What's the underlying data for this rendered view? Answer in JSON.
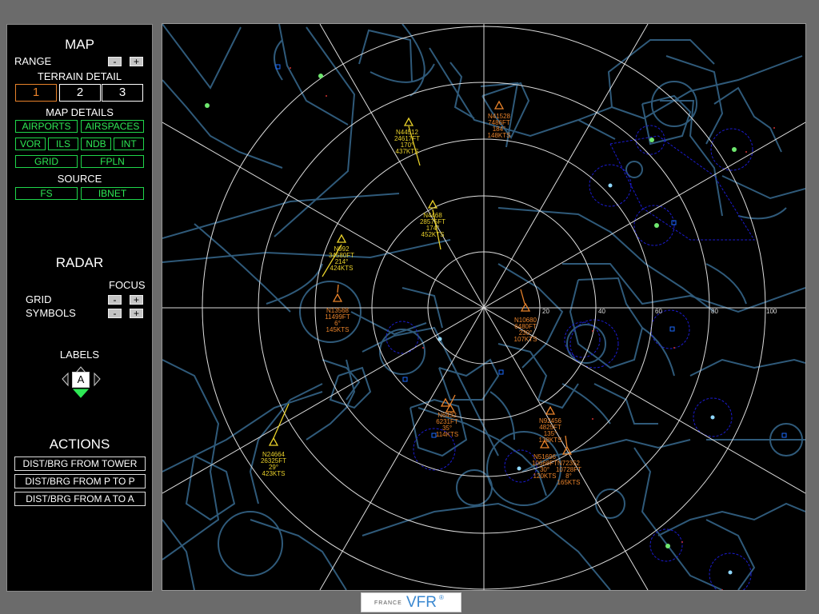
{
  "map": {
    "title": "MAP",
    "range_label": "RANGE",
    "terrain_detail_label": "TERRAIN DETAIL",
    "terrain_levels": [
      "1",
      "2",
      "3"
    ],
    "map_details_label": "MAP DETAILS",
    "detail_buttons": [
      "AIRPORTS",
      "AIRSPACES",
      "VOR",
      "ILS",
      "NDB",
      "INT",
      "GRID",
      "FPLN"
    ],
    "source_label": "SOURCE",
    "source_buttons": [
      "FS",
      "IBNET"
    ]
  },
  "radar_panel": {
    "title": "RADAR",
    "focus_label": "FOCUS",
    "grid_label": "GRID",
    "symbols_label": "SYMBOLS"
  },
  "labels": {
    "title": "LABELS",
    "mode": "A"
  },
  "actions": {
    "title": "ACTIONS",
    "buttons": [
      "DIST/BRG FROM TOWER",
      "DIST/BRG FROM P TO P",
      "DIST/BRG FROM A TO A"
    ]
  },
  "pm": {
    "minus": "-",
    "plus": "+"
  },
  "scope": {
    "range_ticks": [
      "20",
      "40",
      "60",
      "80",
      "100"
    ],
    "aircraft": [
      {
        "color": "#e8d02a",
        "lines": [
          "N44512",
          "24617FT",
          "170°",
          "437KTS"
        ]
      },
      {
        "color": "#e8822a",
        "lines": [
          "N41528",
          "7486FT",
          "184°",
          "148KTS"
        ]
      },
      {
        "color": "#e8d02a",
        "lines": [
          "N4468",
          "28575FT",
          "174°",
          "452KTS"
        ]
      },
      {
        "color": "#e8d02a",
        "lines": [
          "N992",
          "34580FT",
          "214°",
          "424KTS"
        ]
      },
      {
        "color": "#e8822a",
        "lines": [
          "N13568",
          "11499FT",
          "6°",
          "145KTS"
        ]
      },
      {
        "color": "#e8822a",
        "lines": [
          "N10680",
          "6480FT",
          "230°",
          "107KTS"
        ]
      },
      {
        "color": "#e8822a",
        "lines": [
          "N6432",
          "6231FT",
          "35°",
          "114KTS"
        ]
      },
      {
        "color": "#e8822a",
        "lines": [
          "N92456",
          "4825FT",
          "135°",
          "138KTS"
        ]
      },
      {
        "color": "#e8822a",
        "lines": [
          "N51696",
          "10668FT",
          "30°",
          "120KTS"
        ]
      },
      {
        "color": "#e8822a",
        "lines": [
          "N72352",
          "10728FT",
          "8°",
          "165KTS"
        ]
      },
      {
        "color": "#e8d02a",
        "lines": [
          "N24664",
          "26325FT",
          "29°",
          "423KTS"
        ]
      }
    ]
  },
  "logo": {
    "small": "FRANCE",
    "big": "VFR",
    "mark": "®"
  },
  "colors": {
    "background": "#000000",
    "map_lines": "#2f5a7a",
    "range_rings": "#dddddd",
    "button_green": "#1fd64a",
    "selected_orange": "#e8822a",
    "aircraft_yellow": "#e8d02a",
    "aircraft_orange": "#e8822a",
    "navaid_blue": "#1b1bd0"
  }
}
